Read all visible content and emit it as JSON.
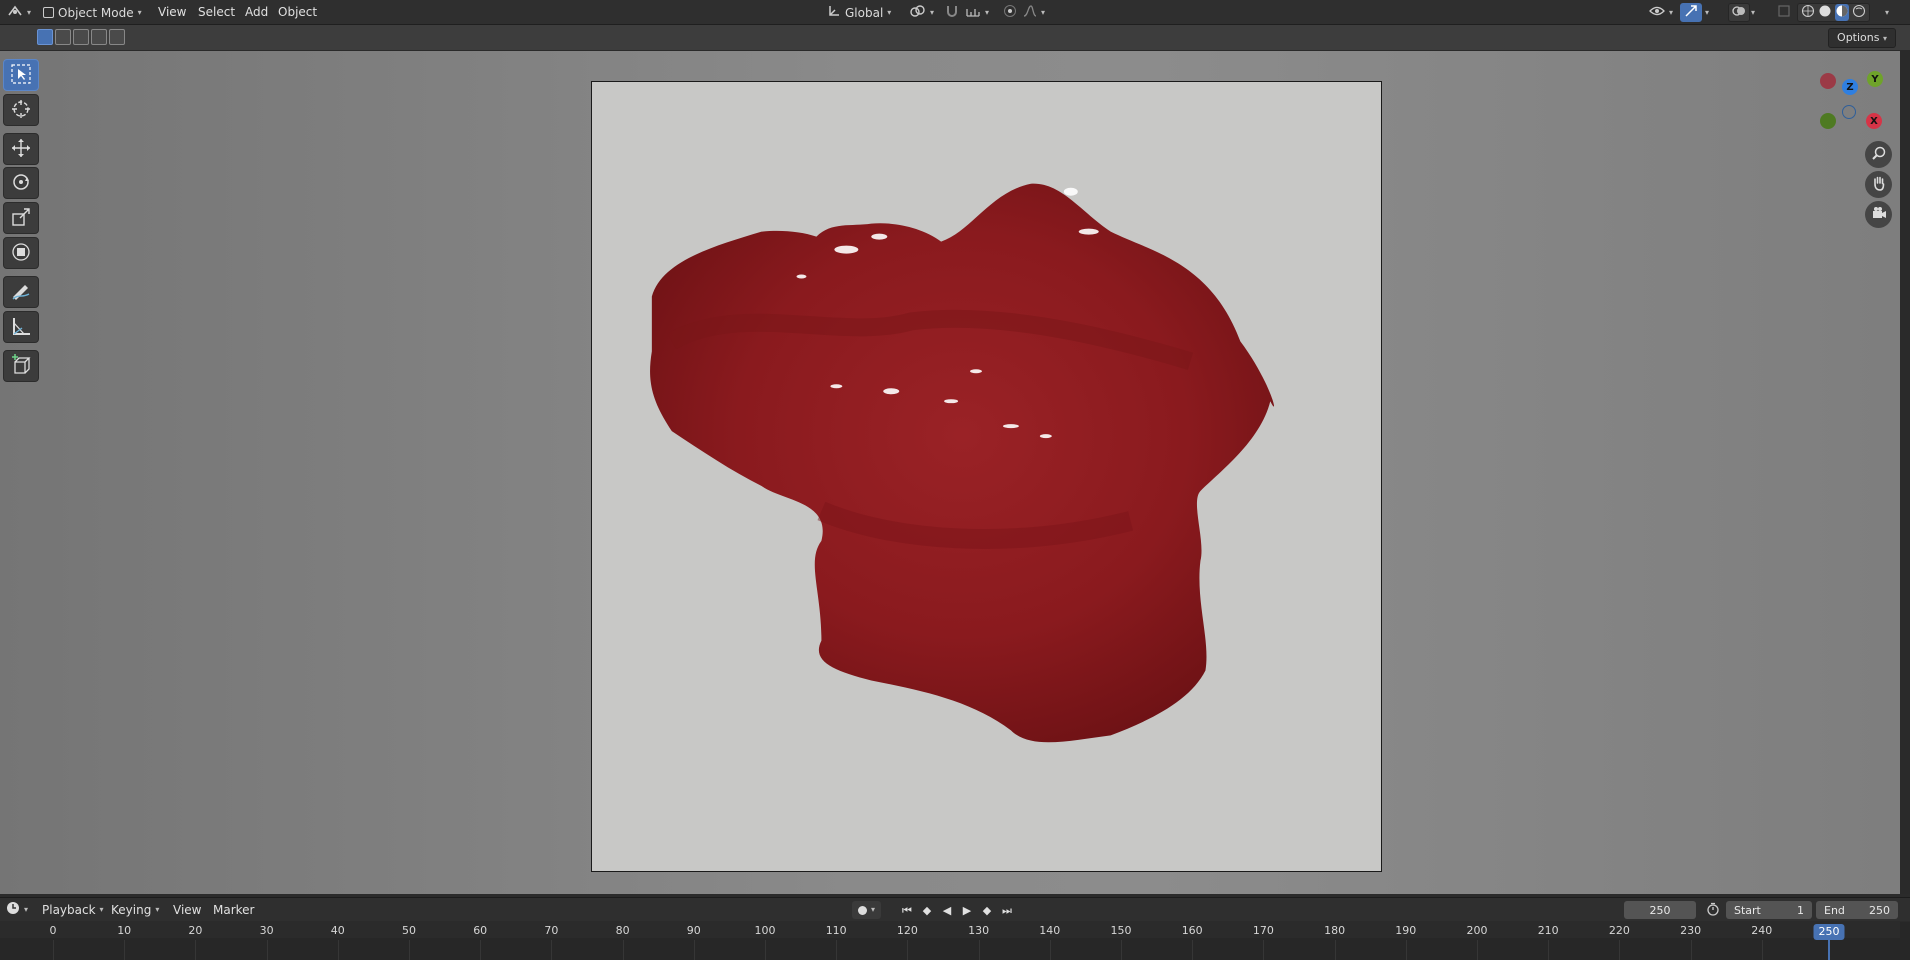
{
  "header": {
    "editor_type_icon": "viewport-editor-icon",
    "mode": "Object Mode",
    "menus": [
      "View",
      "Select",
      "Add",
      "Object"
    ],
    "orientation": "Global"
  },
  "toolsettings": {
    "options_label": "Options"
  },
  "tools": [
    {
      "name": "select-box-tool",
      "icon": "cursor-box-icon",
      "active": true
    },
    {
      "name": "cursor-tool",
      "icon": "crosshair-icon",
      "active": false
    },
    {
      "name": "move-tool",
      "icon": "move-arrows-icon",
      "active": false
    },
    {
      "name": "rotate-tool",
      "icon": "rotate-icon",
      "active": false
    },
    {
      "name": "scale-tool",
      "icon": "scale-icon",
      "active": false
    },
    {
      "name": "transform-tool",
      "icon": "transform-icon",
      "active": false
    },
    {
      "name": "annotate-tool",
      "icon": "pencil-icon",
      "active": false
    },
    {
      "name": "measure-tool",
      "icon": "ruler-icon",
      "active": false
    },
    {
      "name": "add-cube-tool",
      "icon": "cube-add-icon",
      "active": false
    }
  ],
  "gizmo": {
    "axes": [
      {
        "label": "Y",
        "color": "#6fa32a"
      },
      {
        "label": "Z",
        "color": "#2f7fe0"
      },
      {
        "label": "X",
        "color": "#d63447"
      }
    ]
  },
  "timeline": {
    "menus": [
      "Playback",
      "Keying",
      "View",
      "Marker"
    ],
    "current_frame": "250",
    "start_label": "Start",
    "start_value": "1",
    "end_label": "End",
    "end_value": "250",
    "ticks": [
      "0",
      "10",
      "20",
      "30",
      "40",
      "50",
      "60",
      "70",
      "80",
      "90",
      "100",
      "110",
      "120",
      "130",
      "140",
      "150",
      "160",
      "170",
      "180",
      "190",
      "200",
      "210",
      "220",
      "230",
      "240"
    ],
    "playhead_label": "250"
  },
  "colors": {
    "accent": "#4772b3",
    "object": "#8f1a1d"
  }
}
